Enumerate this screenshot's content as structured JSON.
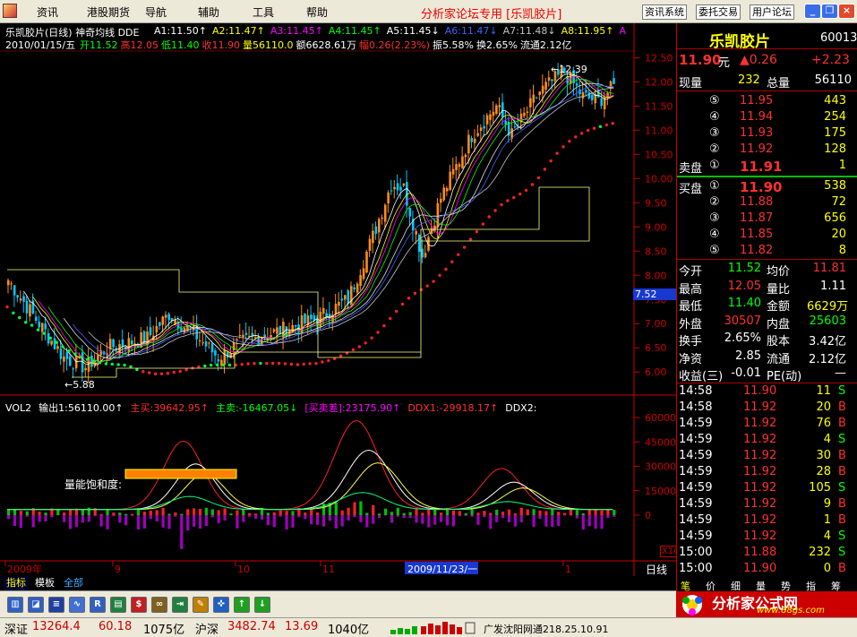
{
  "menubar": {
    "items": [
      "资讯",
      "港股期货",
      "导航",
      "辅助",
      "工具",
      "帮助"
    ],
    "app_title": "分析家论坛专用 [乐凯胶片]",
    "buttons": [
      "资讯系统",
      "委托交易",
      "用户论坛"
    ]
  },
  "chart": {
    "title_line": "乐凯胶片(日线) 神奇均线 DDE",
    "ma_labels": [
      {
        "text": "A1:11.50↑",
        "color": "#ffffff"
      },
      {
        "text": "A2:11.47↑",
        "color": "#ffff00"
      },
      {
        "text": "A3:11.45↑",
        "color": "#ff00ff"
      },
      {
        "text": "A4:11.45↑",
        "color": "#00ff00"
      },
      {
        "text": "A5:11.45↓",
        "color": "#ffffff"
      },
      {
        "text": "A6:11.47↓",
        "color": "#4060ff"
      },
      {
        "text": "A7:11.48↓",
        "color": "#c0c0c0"
      },
      {
        "text": "A8:11.95↑",
        "color": "#ffff00"
      },
      {
        "text": "A",
        "color": "#ff00ff"
      }
    ],
    "date_line": "2010/01/15/五",
    "ohlc": [
      {
        "text": "开11.52",
        "color": "#00ff00"
      },
      {
        "text": "高12.05",
        "color": "#ff3030"
      },
      {
        "text": "低11.40",
        "color": "#00ff00"
      },
      {
        "text": "收11.90",
        "color": "#ff3030"
      },
      {
        "text": "量56110.0",
        "color": "#ffff00"
      },
      {
        "text": "额6628.61万",
        "color": "#ffffff"
      },
      {
        "text": "幅0.26(2.23%)",
        "color": "#ff3030"
      },
      {
        "text": "振5.58%",
        "color": "#ffffff"
      },
      {
        "text": "换2.65%",
        "color": "#ffffff"
      },
      {
        "text": "流通2.12亿",
        "color": "#ffffff"
      }
    ],
    "price_axis": [
      "12.50",
      "12.00",
      "11.50",
      "11.00",
      "10.50",
      "10.00",
      "9.50",
      "9.00",
      "8.50",
      "8.00",
      "7.50",
      "7.00",
      "6.50",
      "6.00"
    ],
    "price_marker": "7.52",
    "high_label": "12.39",
    "low_label": "5.88",
    "vol_line": [
      {
        "text": "VOL2",
        "color": "#ffffff"
      },
      {
        "text": "输出1:56110.00↑",
        "color": "#ffffff"
      },
      {
        "text": "主买:39642.95↑",
        "color": "#ff3030"
      },
      {
        "text": "主卖:-16467.05↓",
        "color": "#00ff00"
      },
      {
        "text": "[买卖差]:23175.90↑",
        "color": "#ff00ff"
      },
      {
        "text": "DDX1:-29918.17↑",
        "color": "#ff3030"
      },
      {
        "text": "DDX2:",
        "color": "#ffffff"
      }
    ],
    "vol_axis": [
      "60000",
      "45000",
      "30000",
      "15000",
      "0"
    ],
    "saturation_label": "量能饱和度:",
    "x10": "X10",
    "date_axis": [
      "2009年",
      "9",
      "10",
      "11",
      "2009/11/23/一",
      "1"
    ],
    "period": "日线"
  },
  "chart_data": {
    "type": "candlestick",
    "title": "乐凯胶片(日线)",
    "ylim": [
      5.8,
      12.6
    ],
    "last": {
      "open": 11.52,
      "high": 12.05,
      "low": 11.4,
      "close": 11.9,
      "volume": 56110
    },
    "annotated_high": 12.39,
    "annotated_low": 5.88
  },
  "tabs": [
    "指标",
    "模板",
    "全部"
  ],
  "toolbar": {
    "icons": [
      "chart-icon",
      "drawline-icon",
      "f10-icon",
      "wave-icon",
      "rsi-icon",
      "layout-icon",
      "dollar-icon",
      "link-icon",
      "export-icon",
      "pen-icon",
      "cross-icon",
      "up-arrow-icon",
      "down-arrow-icon"
    ]
  },
  "status": {
    "sz_label": "深证",
    "sz_index": "13264.4",
    "sz_change": "60.18",
    "sz_amount": "1075亿",
    "sh_label": "沪深",
    "sh_index": "3482.74",
    "sh_change": "13.69",
    "sh_amount": "1040亿",
    "broker": "广发沈阳网通218.25.10.91"
  },
  "quote": {
    "name": "乐凯胶片",
    "code": "600135",
    "price": "11.90",
    "unit": "元",
    "change": "▲0.26",
    "pct": "+2.23",
    "now_vol_label": "现量",
    "now_vol": "232",
    "total_vol_label": "总量",
    "total_vol": "56110",
    "asks": [
      {
        "lvl": "⑤",
        "p": "11.95",
        "v": "443"
      },
      {
        "lvl": "④",
        "p": "11.94",
        "v": "254"
      },
      {
        "lvl": "③",
        "p": "11.93",
        "v": "175"
      },
      {
        "lvl": "②",
        "p": "11.92",
        "v": "128"
      },
      {
        "lvl": "①",
        "p": "11.91",
        "v": "1"
      }
    ],
    "ask_label": "卖盘",
    "bid_label": "买盘",
    "bids": [
      {
        "lvl": "①",
        "p": "11.90",
        "v": "538"
      },
      {
        "lvl": "②",
        "p": "11.88",
        "v": "72"
      },
      {
        "lvl": "③",
        "p": "11.87",
        "v": "656"
      },
      {
        "lvl": "④",
        "p": "11.85",
        "v": "20"
      },
      {
        "lvl": "⑤",
        "p": "11.82",
        "v": "8"
      }
    ],
    "stats": [
      {
        "l1": "今开",
        "v1": "11.52",
        "c1": "#00ff00",
        "l2": "均价",
        "v2": "11.81",
        "c2": "#ff3030"
      },
      {
        "l1": "最高",
        "v1": "12.05",
        "c1": "#ff3030",
        "l2": "量比",
        "v2": "1.11",
        "c2": "#ffffff"
      },
      {
        "l1": "最低",
        "v1": "11.40",
        "c1": "#00ff00",
        "l2": "金额",
        "v2": "6629万",
        "c2": "#ffff00"
      },
      {
        "l1": "外盘",
        "v1": "30507",
        "c1": "#ff3030",
        "l2": "内盘",
        "v2": "25603",
        "c2": "#00ff00"
      },
      {
        "l1": "换手",
        "v1": "2.65%",
        "c1": "#ffffff",
        "l2": "股本",
        "v2": "3.42亿",
        "c2": "#ffffff"
      },
      {
        "l1": "净资",
        "v1": "2.85",
        "c1": "#ffffff",
        "l2": "流通",
        "v2": "2.12亿",
        "c2": "#ffffff"
      },
      {
        "l1": "收益(三)",
        "v1": "-0.01",
        "c1": "#ffffff",
        "l2": "PE(动)",
        "v2": "—",
        "c2": "#ffffff"
      }
    ],
    "ticks": [
      {
        "t": "14:58",
        "p": "11.90",
        "v": "11",
        "s": "S"
      },
      {
        "t": "14:58",
        "p": "11.92",
        "v": "20",
        "s": "B"
      },
      {
        "t": "14:59",
        "p": "11.92",
        "v": "76",
        "s": "B"
      },
      {
        "t": "14:59",
        "p": "11.92",
        "v": "4",
        "s": "S"
      },
      {
        "t": "14:59",
        "p": "11.92",
        "v": "30",
        "s": "B"
      },
      {
        "t": "14:59",
        "p": "11.92",
        "v": "28",
        "s": "B"
      },
      {
        "t": "14:59",
        "p": "11.92",
        "v": "105",
        "s": "S"
      },
      {
        "t": "14:59",
        "p": "11.92",
        "v": "9",
        "s": "B"
      },
      {
        "t": "14:59",
        "p": "11.92",
        "v": "1",
        "s": "B"
      },
      {
        "t": "14:59",
        "p": "11.92",
        "v": "4",
        "s": "S"
      },
      {
        "t": "15:00",
        "p": "11.88",
        "v": "232",
        "s": "S"
      },
      {
        "t": "15:00",
        "p": "11.90",
        "v": "0",
        "s": "B"
      }
    ],
    "bottom_tabs": [
      "笔",
      "价",
      "细",
      "量",
      "势",
      "指",
      "筹"
    ]
  },
  "ad": {
    "text": "分析家公式网",
    "url": "www.88gs.com"
  }
}
